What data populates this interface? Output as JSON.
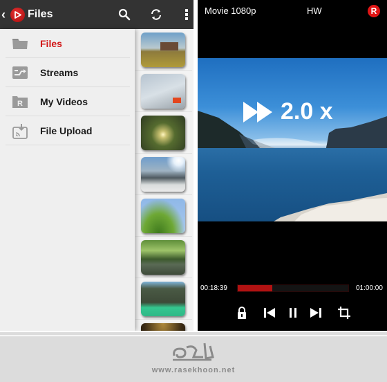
{
  "left_app": {
    "title": "Files",
    "back_icon": "chevron-left-icon",
    "toolbar_icons": [
      "search-icon",
      "refresh-icon",
      "more-vert-icon"
    ],
    "menu": [
      {
        "label": "Files",
        "icon": "folder-icon",
        "active": true
      },
      {
        "label": "Streams",
        "icon": "streams-icon",
        "active": false
      },
      {
        "label": "My Videos",
        "icon": "my-videos-icon",
        "active": false
      },
      {
        "label": "File Upload",
        "icon": "file-upload-icon",
        "active": false
      }
    ],
    "thumbnails": [
      "farmhouse-field",
      "ice-climbing",
      "grapes-sunlight",
      "snowy-mountains",
      "palm-leaves",
      "green-river",
      "turquoise-canyon",
      "dark-partial"
    ]
  },
  "player": {
    "title": "Movie 1080p",
    "decoder": "HW",
    "badge": "R",
    "speed_text": "2.0 x",
    "elapsed": "00:18:39",
    "duration": "01:00:00",
    "progress_fraction": 0.31,
    "controls": [
      "lock-icon",
      "skip-previous-icon",
      "pause-icon",
      "skip-next-icon",
      "crop-icon"
    ]
  },
  "colors": {
    "accent_red": "#d21616",
    "appbar": "#333333",
    "seek_fill": "#b11212"
  },
  "watermark": {
    "url": "www.rasekhoon.net"
  }
}
